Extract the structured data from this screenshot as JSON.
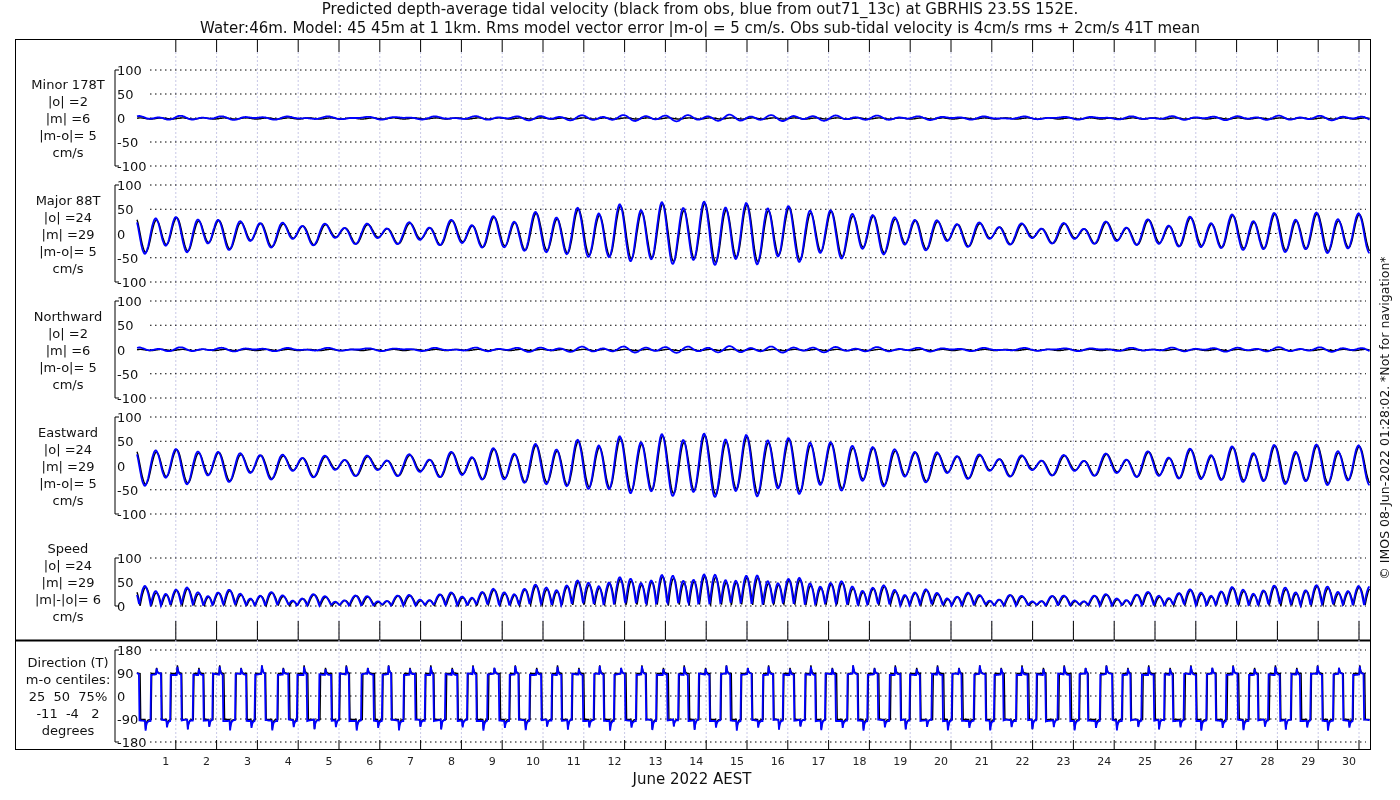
{
  "title": [
    "Predicted depth-average tidal velocity (black from obs, blue from out71_13c) at GBRHIS 23.5S 152E.",
    "Water:46m. Model: 45 45m at 1 1km. Rms model vector error |m-o| = 5 cm/s. Obs sub-tidal velocity is 4cm/s rms + 2cm/s 41T mean"
  ],
  "traces": [
    {
      "color": "#000000"
    },
    {
      "color": "#0000ff"
    }
  ],
  "panels": [
    {
      "kind": "weak",
      "label": [
        "Minor 178T",
        "|o| =2",
        "|m| =6",
        "|m-o|= 5",
        "cm/s"
      ],
      "yticks": [
        "100",
        "50",
        "0",
        "-50",
        "-100"
      ]
    },
    {
      "kind": "strong",
      "label": [
        "Major 88T",
        "|o| =24",
        "|m| =29",
        "|m-o|= 5",
        "cm/s"
      ],
      "yticks": [
        "100",
        "50",
        "0",
        "-50",
        "-100"
      ]
    },
    {
      "kind": "weak",
      "label": [
        "Northward",
        "|o| =2",
        "|m| =6",
        "|m-o|= 5",
        "cm/s"
      ],
      "yticks": [
        "100",
        "50",
        "0",
        "-50",
        "-100"
      ]
    },
    {
      "kind": "strong",
      "label": [
        "Eastward",
        "|o| =24",
        "|m| =29",
        "|m-o|= 5",
        "cm/s"
      ],
      "yticks": [
        "100",
        "50",
        "0",
        "-50",
        "-100"
      ]
    },
    {
      "kind": "speed",
      "label": [
        "Speed",
        "|o| =24",
        "|m| =29",
        "|m|-|o|= 6",
        "cm/s"
      ],
      "yticks": [
        "100",
        "50",
        "0"
      ]
    },
    {
      "kind": "direction",
      "label": [
        "Direction (T)",
        "m-o centiles:",
        "25  50  75%",
        "-11  -4   2",
        "degrees"
      ],
      "yticks": [
        "180",
        "90",
        "0",
        "-90",
        "-180"
      ]
    }
  ],
  "xticks": [
    "1",
    "2",
    "3",
    "4",
    "5",
    "6",
    "7",
    "8",
    "9",
    "10",
    "11",
    "12",
    "13",
    "14",
    "15",
    "16",
    "17",
    "18",
    "19",
    "20",
    "21",
    "22",
    "23",
    "24",
    "25",
    "26",
    "27",
    "28",
    "29",
    "30"
  ],
  "xlabel": "June 2022 AEST",
  "footer": "© IMOS 08-Jun-2022 01:28:02. *Not for navigation*"
}
